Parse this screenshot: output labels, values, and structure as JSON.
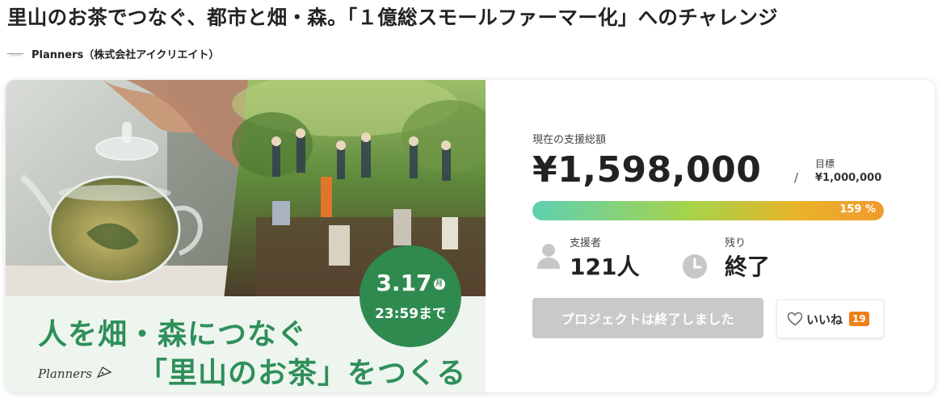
{
  "project": {
    "title": "里山のお茶でつなぐ、都市と畑・森。「１億総スモールファーマー化」へのチャレンジ",
    "owner": "Planners（株式会社アイクリエイト）"
  },
  "hero": {
    "headline_line1": "人を畑・森につなぐ",
    "headline_line2": "「里山のお茶」をつくる",
    "brand": "Planners",
    "deadline_date": "3.17",
    "deadline_month_mark": "月",
    "deadline_time": "23:59まで",
    "badge_color": "#2f8a4f",
    "headline_color": "#2f8f5a"
  },
  "stats": {
    "total_label": "現在の支援総額",
    "total_amount": "¥1,598,000",
    "slash": "/",
    "goal_label": "目標",
    "goal_value": "¥1,000,000",
    "progress_percent": 159,
    "progress_text": "159 %",
    "supporters_label": "支援者",
    "supporters_value": "121人",
    "remaining_label": "残り",
    "remaining_value": "終了",
    "ended_button_label": "プロジェクトは終了しました",
    "like_label": "いいね",
    "like_count": "19",
    "icons": {
      "supporters": "person-icon",
      "remaining": "clock-icon",
      "like": "heart-icon"
    },
    "accent_color": "#ef7f1a"
  }
}
